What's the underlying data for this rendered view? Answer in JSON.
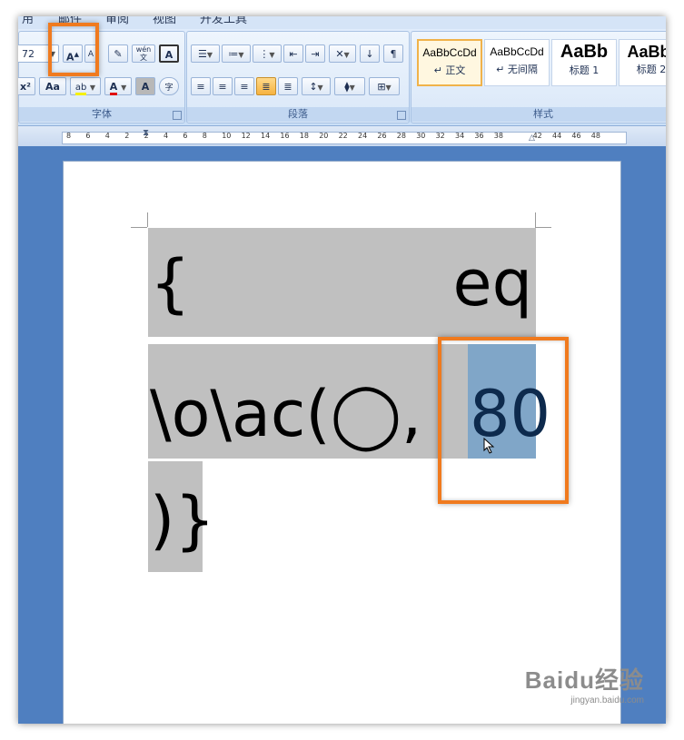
{
  "menu": {
    "tabs": [
      "用",
      "邮件",
      "审阅",
      "视图",
      "开发工具"
    ]
  },
  "font_group": {
    "label": "字体",
    "font_size": "72",
    "grow_font_glyph": "A",
    "highlight_glyph": "ab",
    "font_color_glyph": "A",
    "change_case_glyph": "Aa",
    "superscript_glyph": "x²",
    "char_shading_glyph": "A",
    "enclose_glyph": "字",
    "phonetic_glyph": "wén 文"
  },
  "paragraph_group": {
    "label": "段落"
  },
  "styles_group": {
    "label": "样式",
    "items": [
      {
        "sample": "AaBbCcDd",
        "name": "↵ 正文"
      },
      {
        "sample": "AaBbCcDd",
        "name": "↵ 无间隔"
      },
      {
        "sample": "AaBb",
        "name": "标题 1"
      },
      {
        "sample": "AaBb(",
        "name": "标题 2"
      }
    ]
  },
  "ruler": {
    "ticks": [
      "8",
      "6",
      "4",
      "2",
      "2",
      "4",
      "6",
      "8",
      "10",
      "12",
      "14",
      "16",
      "18",
      "20",
      "22",
      "24",
      "26",
      "28",
      "30",
      "32",
      "34",
      "36",
      "38",
      "42",
      "44",
      "46",
      "48"
    ]
  },
  "document": {
    "line1_open": "{",
    "line1_code": "eq",
    "line2_text": "\\o\\ac(◯,",
    "line2_selected": "80",
    "line3_text": ")}"
  },
  "colors": {
    "field_shading": "#c0c0c0",
    "selection": "#80a6c8",
    "callout": "#f07a1e"
  },
  "watermark": {
    "brand": "Baidu经验",
    "url": "jingyan.baidu.com"
  }
}
